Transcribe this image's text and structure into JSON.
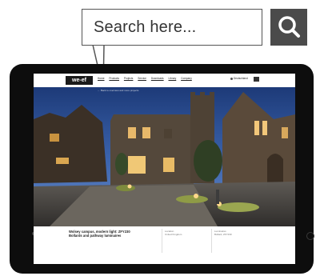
{
  "search": {
    "placeholder": "Search here..."
  },
  "site": {
    "logo": "we-ef",
    "nav": [
      "Home",
      "Products",
      "Projects",
      "Service",
      "Downloads",
      "Library",
      "Company"
    ],
    "language": "Deutschland",
    "breadcrumb": "← Back to overview and more projects"
  },
  "project": {
    "title_line1": "Wolsey campus, modern light: ZFY230",
    "title_line2": "Bollards and pathway luminaires",
    "col1_label": "Location",
    "col1_value": "United Kingdom",
    "col2_label": "Luminaires",
    "col2_value": "Bollard, ZFY230"
  },
  "colors": {
    "search_button": "#4b4b4b",
    "tablet": "#0d0d0d",
    "sky": "#2c4f92"
  }
}
